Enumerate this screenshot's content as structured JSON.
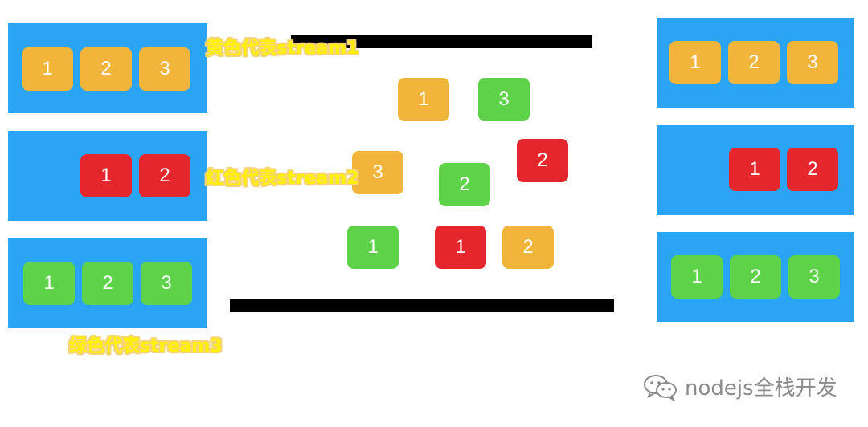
{
  "colors": {
    "panel": "#2aa4f4",
    "yellow": "#f2b53b",
    "red": "#e5272d",
    "green": "#5ed34a",
    "bar": "#000000"
  },
  "labels": {
    "yellow": "黄色代表stream1",
    "red": "红色代表stream2",
    "green": "绿色代表stream3"
  },
  "left_streams": [
    {
      "color": "yellow",
      "items": [
        "1",
        "2",
        "3"
      ]
    },
    {
      "color": "red",
      "items": [
        "1",
        "2"
      ]
    },
    {
      "color": "green",
      "items": [
        "1",
        "2",
        "3"
      ]
    }
  ],
  "middle_packets": [
    {
      "color": "yellow",
      "text": "1"
    },
    {
      "color": "green",
      "text": "3"
    },
    {
      "color": "yellow",
      "text": "3"
    },
    {
      "color": "green",
      "text": "2"
    },
    {
      "color": "red",
      "text": "2"
    },
    {
      "color": "green",
      "text": "1"
    },
    {
      "color": "red",
      "text": "1"
    },
    {
      "color": "yellow",
      "text": "2"
    }
  ],
  "right_streams": [
    {
      "color": "yellow",
      "items": [
        "1",
        "2",
        "3"
      ]
    },
    {
      "color": "red",
      "items": [
        "1",
        "2"
      ]
    },
    {
      "color": "green",
      "items": [
        "1",
        "2",
        "3"
      ]
    }
  ],
  "watermark": {
    "icon": "wechat-icon",
    "text": "nodejs全栈开发"
  }
}
